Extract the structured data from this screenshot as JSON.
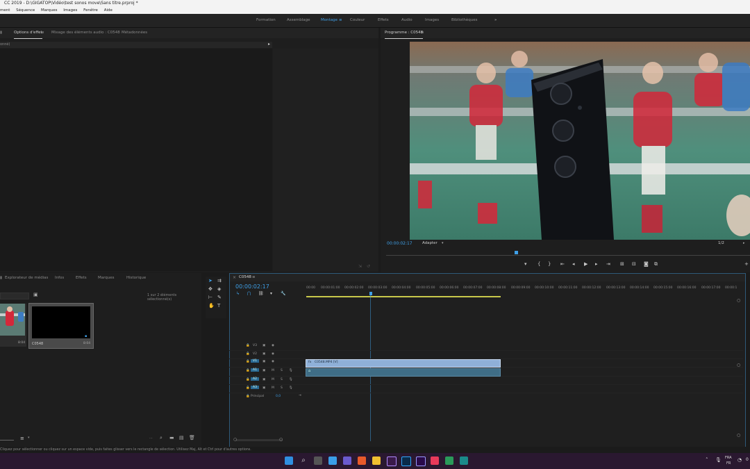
{
  "window": {
    "title": "CC 2019 - D:\\GIGATOP\\Vidéo\\test sonos move\\Sans titre.prproj *"
  },
  "menu": [
    "ment",
    "Séquence",
    "Marques",
    "Images",
    "Fenêtre",
    "Aide"
  ],
  "workspaces": {
    "items": [
      "Formation",
      "Assemblage",
      "Montage",
      "Couleur",
      "Effets",
      "Audio",
      "Images",
      "Bibliothèques"
    ],
    "active": "Montage",
    "more": "»"
  },
  "effect_panel": {
    "tabs": [
      "Options d'effet",
      "Mixage des éléments audio : C0548",
      "Métadonnées"
    ],
    "left_label": "onné)"
  },
  "program_monitor": {
    "title": "Programme : C0548",
    "timecode": "00:00:02:17",
    "fit": "Adapter",
    "quality": "1/2"
  },
  "project_panel": {
    "tabs": [
      "Explorateur de médias",
      "Infos",
      "Effets",
      "Marques",
      "Historique"
    ],
    "selection_info": "1 sur 2 éléments sélectionné(s)",
    "items": [
      {
        "name": "",
        "duration": "8:04"
      },
      {
        "name": "C0548",
        "duration": "8:04"
      }
    ]
  },
  "timeline": {
    "sequence_tab": "C0548",
    "timecode": "00:00:02:17",
    "ruler": [
      "00:00",
      "00:00:01:00",
      "00:00:02:00",
      "00:00:03:00",
      "00:00:04:00",
      "00:00:05:00",
      "00:00:06:00",
      "00:00:07:00",
      "00:00:08:00",
      "00:00:09:00",
      "00:00:10:00",
      "00:00:11:00",
      "00:00:12:00",
      "00:00:13:00",
      "00:00:14:00",
      "00:00:15:00",
      "00:00:16:00",
      "00:00:17:00",
      "00:00:1"
    ],
    "video_tracks": [
      "V3",
      "V2",
      "V1"
    ],
    "audio_tracks": [
      "A1",
      "A2",
      "A3"
    ],
    "track_buttons": {
      "mute": "M",
      "solo": "S"
    },
    "master_label": "Principal",
    "master_value": "0,0",
    "clip_name": "C0548.MP4 [V]"
  },
  "status_bar": {
    "text": "Cliquez pour sélectionner ou cliquez sur un espace vide, puis faites glisser vers le rectangle de sélection. Utilisez Maj, Alt et Ctrl pour d'autres options."
  },
  "taskbar": {
    "lang_top": "FRA",
    "lang_bottom": "FR",
    "clock": "0"
  },
  "colors": {
    "accent": "#3f9fe6",
    "clip_video": "#8fb0d8",
    "clip_audio": "#3f6d86",
    "work_area": "#c8c84a",
    "taskbar": "#2a1830"
  }
}
